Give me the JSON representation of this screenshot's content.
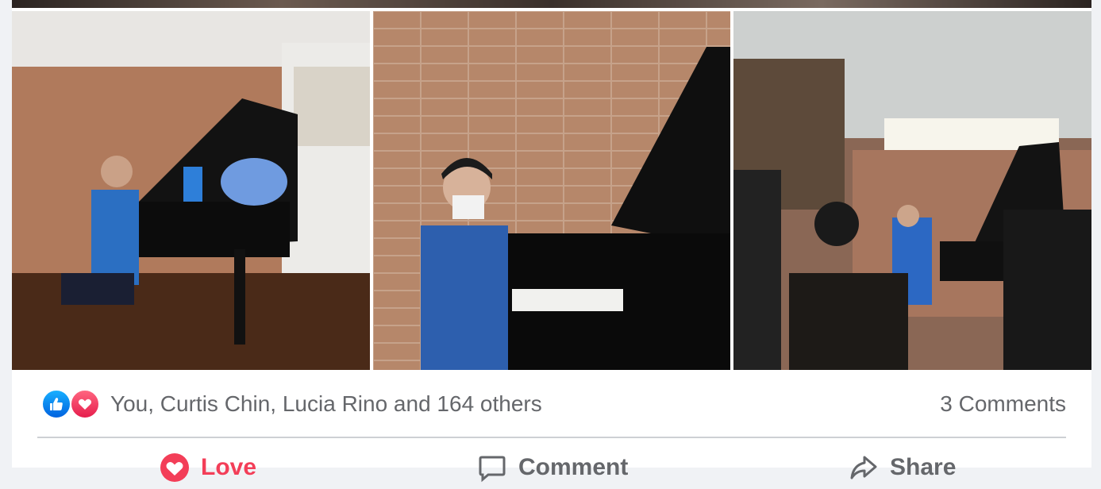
{
  "post": {
    "photos": [
      {
        "name": "photo-pianist-seated-bouquet"
      },
      {
        "name": "photo-pianist-masked-at-piano"
      },
      {
        "name": "photo-pianist-performing-audience"
      }
    ],
    "reactions": {
      "icons": [
        "like-icon",
        "love-icon"
      ],
      "summary_text": "You, Curtis Chin, Lucia Rino and 164 others",
      "comments_text": "3 Comments"
    },
    "actions": [
      {
        "label": "Love",
        "icon": "heart-icon",
        "color": "#f33e58"
      },
      {
        "label": "Comment",
        "icon": "comment-bubble-icon",
        "color": "#65676b"
      },
      {
        "label": "Share",
        "icon": "share-arrow-icon",
        "color": "#65676b"
      }
    ]
  },
  "colors": {
    "like_blue": "#1877f2",
    "love_red": "#f33e58",
    "secondary_text": "#65676b",
    "divider": "#ced0d4"
  }
}
